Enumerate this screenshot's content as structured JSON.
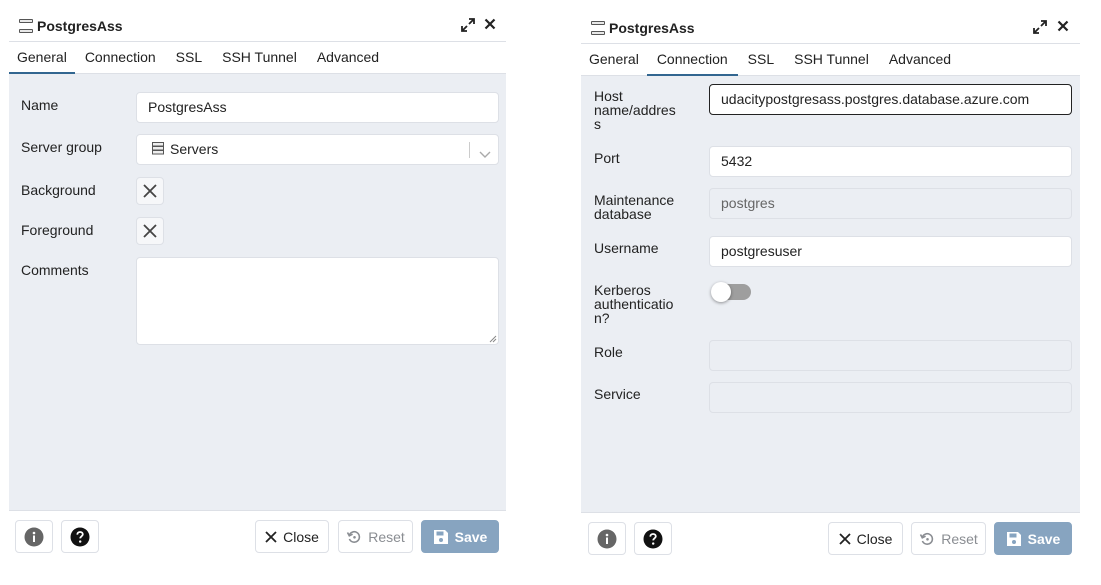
{
  "left": {
    "title": "PostgresAss",
    "tabs": [
      "General",
      "Connection",
      "SSL",
      "SSH Tunnel",
      "Advanced"
    ],
    "active_tab": "General",
    "fields": {
      "name_label": "Name",
      "name_value": "PostgresAss",
      "server_group_label": "Server group",
      "server_group_value": "Servers",
      "background_label": "Background",
      "foreground_label": "Foreground",
      "comments_label": "Comments"
    },
    "footer": {
      "close": "Close",
      "reset": "Reset",
      "save": "Save"
    }
  },
  "right": {
    "title": "PostgresAss",
    "tabs": [
      "General",
      "Connection",
      "SSL",
      "SSH Tunnel",
      "Advanced"
    ],
    "active_tab": "Connection",
    "fields": {
      "host_label_line1": "Host",
      "host_label_line2": "name/addres",
      "host_label_line3": "s",
      "host_value": "udacitypostgresass.postgres.database.azure.com",
      "port_label": "Port",
      "port_value": "5432",
      "maint_label_line1": "Maintenance",
      "maint_label_line2": "database",
      "maint_value": "postgres",
      "username_label": "Username",
      "username_value": "postgresuser",
      "kerberos_label_line1": "Kerberos",
      "kerberos_label_line2": "authenticatio",
      "kerberos_label_line3": "n?",
      "kerberos_enabled": false,
      "role_label": "Role",
      "role_value": "",
      "service_label": "Service",
      "service_value": ""
    },
    "footer": {
      "close": "Close",
      "reset": "Reset",
      "save": "Save"
    }
  },
  "colors": {
    "accent": "#326690",
    "panel_bg": "#ebeef3",
    "border": "#dde0e6",
    "save_bg": "#87a4c0",
    "toggle_off": "#9e9e9e"
  },
  "icons": [
    "server-group-icon",
    "expand-icon",
    "close-icon",
    "x-icon",
    "chevron-down-icon",
    "info-icon",
    "help-icon",
    "reset-icon",
    "save-icon"
  ]
}
